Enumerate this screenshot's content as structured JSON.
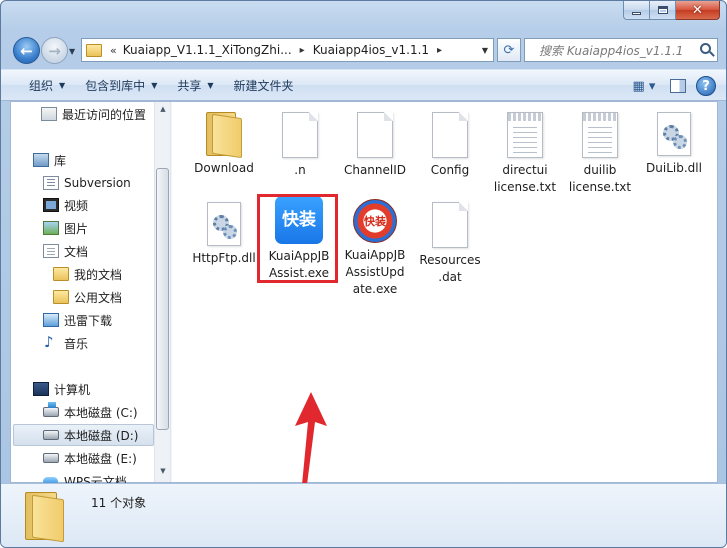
{
  "window": {
    "minimize_label": "minimize",
    "maximize_label": "maximize",
    "close_label": "✕"
  },
  "address": {
    "chevron": "«",
    "segments": [
      "Kuaiapp_V1.1.1_XiTongZhi...",
      "Kuaiapp4ios_v1.1.1"
    ],
    "separator": "▸",
    "dropdown": "▼"
  },
  "search": {
    "placeholder": "搜索 Kuaiapp4ios_v1.1.1"
  },
  "toolbar": {
    "organize": "组织",
    "include_in_library": "包含到库中",
    "share": "共享",
    "new_folder": "新建文件夹",
    "caret": "▼",
    "help": "?"
  },
  "nav": {
    "recent": "最近访问的位置",
    "library": "库",
    "subversion": "Subversion",
    "video": "视频",
    "pictures": "图片",
    "documents": "文档",
    "my_documents": "我的文档",
    "public_documents": "公用文档",
    "xunlei": "迅雷下载",
    "music": "音乐",
    "computer": "计算机",
    "drive_c": "本地磁盘 (C:)",
    "drive_d": "本地磁盘 (D:)",
    "drive_e": "本地磁盘 (E:)",
    "wps": "WPS云文档"
  },
  "files": [
    {
      "name": "Download",
      "type": "folder"
    },
    {
      "name": ".n",
      "type": "file"
    },
    {
      "name": "ChannelID",
      "type": "file"
    },
    {
      "name": "Config",
      "type": "file"
    },
    {
      "name": "directui license.txt",
      "line1": "directui",
      "line2": "license.txt",
      "type": "txt"
    },
    {
      "name": "duilib license.txt",
      "line1": "duilib",
      "line2": "license.txt",
      "type": "txt"
    },
    {
      "name": "DuiLib.dll",
      "type": "dll"
    },
    {
      "name": "HttpFtp.dll",
      "type": "dll"
    },
    {
      "name": "KuaiAppJBAssist.exe",
      "line1": "KuaiAppJB",
      "line2": "Assist.exe",
      "type": "exe",
      "icon_text": "快装"
    },
    {
      "name": "KuaiAppJBAssistUpdate.exe",
      "line1": "KuaiAppJB",
      "line2": "AssistUpd",
      "line3": "ate.exe",
      "type": "exe",
      "icon_text": "快装"
    },
    {
      "name": "Resources.dat",
      "line1": "Resources",
      "line2": ".dat",
      "type": "file"
    }
  ],
  "details": {
    "item_count": "11 个对象"
  },
  "colors": {
    "highlight": "#e0282e",
    "window_frame": "#b5cde8",
    "accent": "#1976e8"
  }
}
